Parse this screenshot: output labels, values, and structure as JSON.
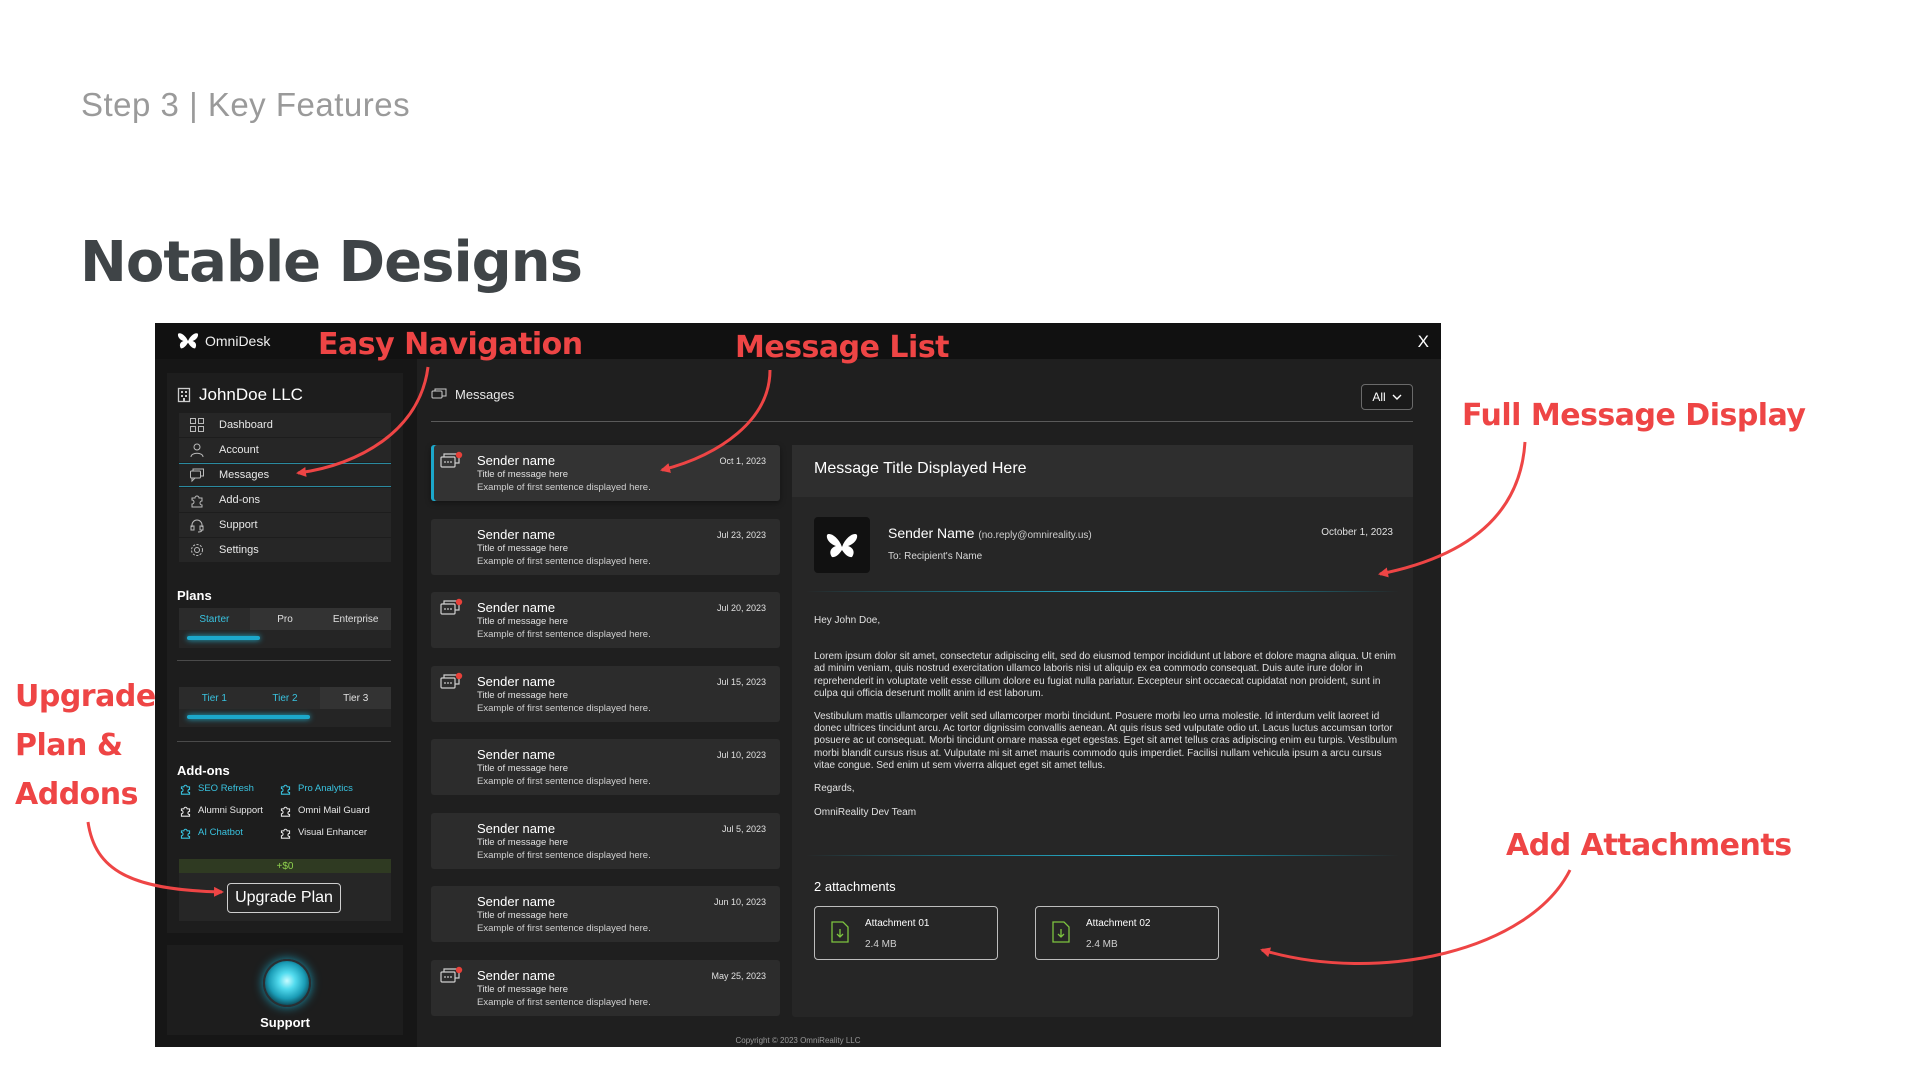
{
  "slide": {
    "step": "Step 3 | Key Features",
    "title": "Notable Designs"
  },
  "annotations": {
    "easy_navigation": "Easy Navigation",
    "message_list": "Message List",
    "full_message_display": "Full Message Display",
    "upgrade_line1": "Upgrade",
    "upgrade_line2": "Plan &",
    "upgrade_line3": "Addons",
    "add_attachments": "Add Attachments"
  },
  "colors": {
    "accent": "#1ca8cb",
    "annotation": "#ee4545",
    "app_bg": "#161616"
  },
  "app": {
    "brand": "OmniDesk",
    "close": "X",
    "company": "JohnDoe LLC",
    "nav": [
      {
        "label": "Dashboard",
        "icon": "grid-icon"
      },
      {
        "label": "Account",
        "icon": "user-icon"
      },
      {
        "label": "Messages",
        "icon": "chat-icon",
        "active": true
      },
      {
        "label": "Add-ons",
        "icon": "puzzle-icon"
      },
      {
        "label": "Support",
        "icon": "headset-icon"
      },
      {
        "label": "Settings",
        "icon": "gear-icon"
      }
    ],
    "plans": {
      "heading": "Plans",
      "tiers": [
        "Starter",
        "Pro",
        "Enterprise"
      ],
      "tiers_progress": 0.37,
      "subtiers": [
        "Tier 1",
        "Tier 2",
        "Tier 3"
      ],
      "subtiers_progress": 0.63
    },
    "addons": {
      "heading": "Add-ons",
      "items": [
        {
          "label": "SEO Refresh",
          "active": true
        },
        {
          "label": "Pro Analytics",
          "active": true
        },
        {
          "label": "Alumni Support",
          "active": false
        },
        {
          "label": "Omni Mail Guard",
          "active": false
        },
        {
          "label": "AI Chatbot",
          "active": true
        },
        {
          "label": "Visual Enhancer",
          "active": false
        }
      ],
      "price": "+$0",
      "upgrade_button": "Upgrade Plan"
    },
    "support": "Support",
    "messages": {
      "heading": "Messages",
      "filter": "All",
      "list": [
        {
          "sender": "Sender name",
          "title": "Title of message here",
          "preview": "Example of first sentence displayed here.",
          "date": "Oct 1, 2023",
          "unread": true,
          "selected": true
        },
        {
          "sender": "Sender name",
          "title": "Title of message here",
          "preview": "Example of first sentence displayed here.",
          "date": "Jul 23, 2023",
          "unread": false
        },
        {
          "sender": "Sender name",
          "title": "Title of message here",
          "preview": "Example of first sentence displayed here.",
          "date": "Jul 20, 2023",
          "unread": true
        },
        {
          "sender": "Sender name",
          "title": "Title of message here",
          "preview": "Example of first sentence displayed here.",
          "date": "Jul 15, 2023",
          "unread": true
        },
        {
          "sender": "Sender name",
          "title": "Title of message here",
          "preview": "Example of first sentence displayed here.",
          "date": "Jul 10, 2023",
          "unread": false
        },
        {
          "sender": "Sender name",
          "title": "Title of message here",
          "preview": "Example of first sentence displayed here.",
          "date": "Jul 5, 2023",
          "unread": false
        },
        {
          "sender": "Sender name",
          "title": "Title of message here",
          "preview": "Example of first sentence displayed here.",
          "date": "Jun 10, 2023",
          "unread": false
        },
        {
          "sender": "Sender name",
          "title": "Title of message here",
          "preview": "Example of first sentence displayed here.",
          "date": "May 25, 2023",
          "unread": true
        }
      ]
    },
    "detail": {
      "title": "Message Title Displayed Here",
      "sender_name": "Sender Name",
      "sender_email": "(no.reply@omnireality.us)",
      "to": "To: Recipient's Name",
      "date": "October 1, 2023",
      "greeting": "Hey John Doe,",
      "para1": "Lorem ipsum dolor sit amet, consectetur adipiscing elit, sed do eiusmod tempor incididunt ut labore et dolore magna aliqua. Ut enim ad minim veniam, quis nostrud exercitation ullamco laboris nisi ut aliquip ex ea commodo consequat. Duis aute irure dolor in reprehenderit in voluptate velit esse cillum dolore eu fugiat nulla pariatur. Excepteur sint occaecat cupidatat non proident, sunt in culpa qui officia deserunt mollit anim id est laborum.",
      "para2": "Vestibulum mattis ullamcorper velit sed ullamcorper morbi tincidunt. Posuere morbi leo urna molestie. Id interdum velit laoreet id donec ultrices tincidunt arcu. Ac tortor dignissim convallis aenean. At quis risus sed vulputate odio ut. Lacus luctus accumsan tortor posuere ac ut consequat. Morbi tincidunt ornare massa eget egestas. Eget sit amet tellus cras adipiscing enim eu turpis. Vestibulum morbi blandit cursus risus at. Vulputate mi sit amet mauris commodo quis imperdiet. Facilisi nullam vehicula ipsum a arcu cursus vitae congue. Sed enim ut sem viverra aliquet eget sit amet tellus.",
      "regards": "Regards,",
      "signature": "OmniReality Dev Team",
      "attachments_heading": "2 attachments",
      "attachments": [
        {
          "name": "Attachment 01",
          "size": "2.4 MB"
        },
        {
          "name": "Attachment 02",
          "size": "2.4 MB"
        }
      ]
    },
    "copyright": "Copyright © 2023 OmniReality LLC"
  }
}
